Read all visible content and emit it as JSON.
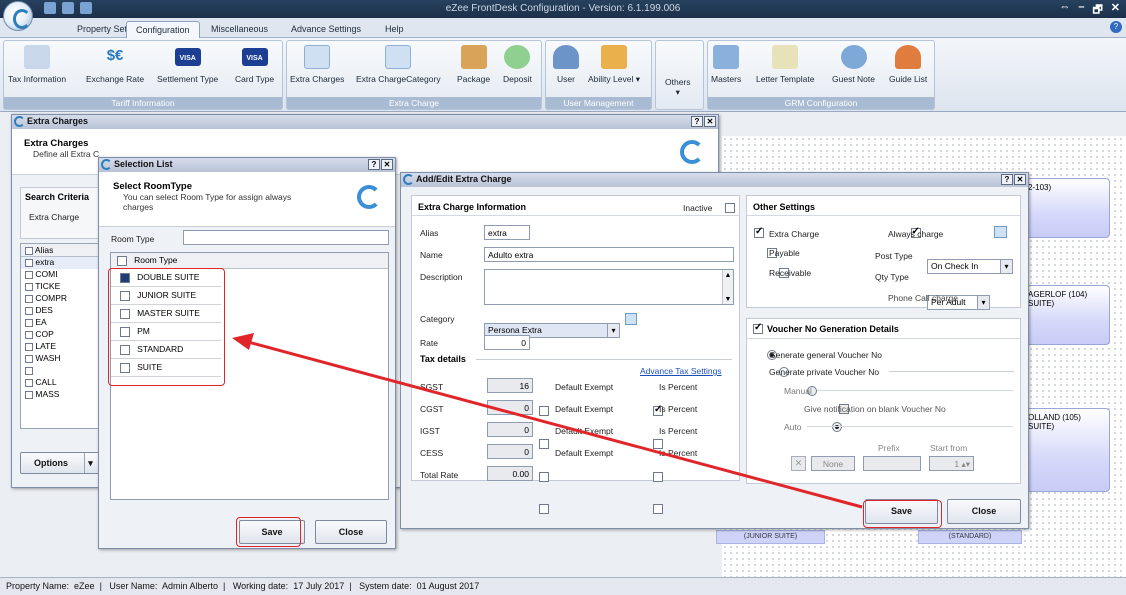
{
  "app": {
    "title": "eZee FrontDesk Configuration - Version: 6.1.199.006",
    "window_controls": [
      "⇔",
      "–",
      "🗗",
      "✕"
    ]
  },
  "menu": {
    "tabs": [
      "Property Setup",
      "Configuration",
      "Miscellaneous",
      "Advance Settings",
      "Help"
    ],
    "active": "Configuration"
  },
  "ribbon": {
    "groups": [
      {
        "label": "Tariff Information",
        "items": [
          "Tax Information",
          "Exchange Rate",
          "Settlement Type",
          "Card Type"
        ]
      },
      {
        "label": "Extra Charge",
        "items": [
          "Extra Charges",
          "Extra ChargeCategory",
          "Package",
          "Deposit"
        ]
      },
      {
        "label": "User Management",
        "items": [
          "User",
          "Ability Level ▾"
        ]
      },
      {
        "label": "",
        "items": [
          "Others"
        ]
      },
      {
        "label": "GRM Configuration",
        "items": [
          "Masters",
          "Letter Template",
          "Guest Note",
          "Guide List"
        ]
      }
    ],
    "icon_text": {
      "exchange": "$€",
      "visa": "VISA"
    }
  },
  "extra_charges_window": {
    "title": "Extra Charges",
    "header_title": "Extra Charges",
    "header_sub": "Define all Extra C",
    "search_criteria": "Search Criteria",
    "filter_label": "Extra Charge",
    "alias_header": "Alias",
    "aliases": [
      "extra",
      "COMI",
      "TICKE",
      "COMPR",
      "DES",
      "EA",
      "COP",
      "LATE",
      "WASH",
      "",
      "CALL",
      "MASS"
    ],
    "options_label": "Options"
  },
  "selection_list": {
    "title": "Selection List",
    "header_title": "Select RoomType",
    "header_sub": "You can select Room Type for assign always charges",
    "room_type_label": "Room Type",
    "room_type_value": "",
    "column_header": "Room Type",
    "rows": [
      "DOUBLE SUITE",
      "JUNIOR SUITE",
      "MASTER SUITE",
      "PM",
      "STANDARD",
      "SUITE"
    ],
    "save_label": "Save",
    "close_label": "Close"
  },
  "add_edit": {
    "title": "Add/Edit Extra Charge",
    "info_title": "Extra Charge Information",
    "inactive_label": "Inactive",
    "alias_label": "Alias",
    "alias_value": "extra",
    "name_label": "Name",
    "name_value": "Adulto extra",
    "description_label": "Description",
    "category_label": "Category",
    "category_value": "Persona Extra",
    "rate_label": "Rate",
    "rate_value": "0",
    "tax_details": "Tax details",
    "advance_tax": "Advance Tax Settings",
    "taxes": [
      {
        "name": "SGST",
        "value": "16",
        "exempt": "Default Exempt",
        "percent": "Is Percent",
        "is_percent": true
      },
      {
        "name": "CGST",
        "value": "0",
        "exempt": "Default Exempt",
        "percent": "Is Percent",
        "is_percent": false
      },
      {
        "name": "IGST",
        "value": "0",
        "exempt": "Default Exempt",
        "percent": "Is Percent",
        "is_percent": false
      },
      {
        "name": "CESS",
        "value": "0",
        "exempt": "Default Exempt",
        "percent": "Is Percent",
        "is_percent": false
      }
    ],
    "total_rate_label": "Total Rate",
    "total_rate_value": "0.00",
    "other_title": "Other Settings",
    "extra_charge_label": "Extra Charge",
    "payable_label": "Payable",
    "receivable_label": "Receivable",
    "always_charge_label": "Always charge",
    "post_type_label": "Post Type",
    "post_type_value": "On Check In",
    "qty_type_label": "Qty Type",
    "qty_type_value": "Per Adult",
    "phone_call_label": "Phone Call charge",
    "voucher_title": "Voucher No Generation Details",
    "gen_general": "Generate general Voucher No",
    "gen_private": "Generate private Voucher No",
    "manual_label": "Manual",
    "notify_label": "Give notification on blank Voucher No",
    "auto_label": "Auto",
    "prefix_label": "Prefix",
    "start_from_label": "Start from",
    "none_label": "None",
    "start_value": "1",
    "save_label": "Save",
    "close_label": "Close"
  },
  "rooms": [
    {
      "label": "2-103)"
    },
    {
      "label": "AGERLOF (104) SUITE)"
    },
    {
      "label": "OLLAND (105) SUITE)"
    },
    {
      "label": "(JUNIOR SUITE)"
    },
    {
      "label": "(STANDARD)"
    }
  ],
  "status": {
    "property_name_label": "Property Name:",
    "property_name": "eZee",
    "user_name_label": "User Name:",
    "user_name": "Admin Alberto",
    "working_date_label": "Working date:",
    "working_date": "17 July 2017",
    "system_date_label": "System date:",
    "system_date": "01 August 2017"
  },
  "colors": {
    "accent": "#2b7fbd",
    "annotation": "#e0262b",
    "ribbon_label": "#a9bbd2"
  }
}
